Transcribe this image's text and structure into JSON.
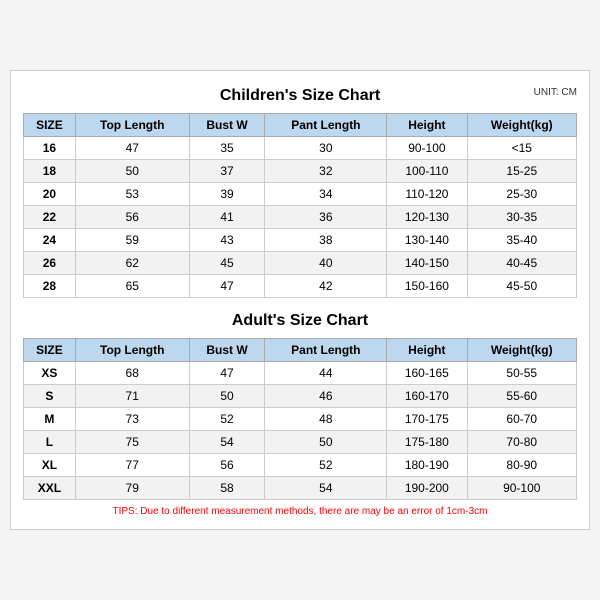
{
  "chart": {
    "title": "Children's Size Chart",
    "unit": "UNIT: CM",
    "children_headers": [
      "SIZE",
      "Top Length",
      "Bust W",
      "Pant Length",
      "Height",
      "Weight(kg)"
    ],
    "children_rows": [
      [
        "16",
        "47",
        "35",
        "30",
        "90-100",
        "<15"
      ],
      [
        "18",
        "50",
        "37",
        "32",
        "100-110",
        "15-25"
      ],
      [
        "20",
        "53",
        "39",
        "34",
        "110-120",
        "25-30"
      ],
      [
        "22",
        "56",
        "41",
        "36",
        "120-130",
        "30-35"
      ],
      [
        "24",
        "59",
        "43",
        "38",
        "130-140",
        "35-40"
      ],
      [
        "26",
        "62",
        "45",
        "40",
        "140-150",
        "40-45"
      ],
      [
        "28",
        "65",
        "47",
        "42",
        "150-160",
        "45-50"
      ]
    ],
    "adult_title": "Adult's Size Chart",
    "adult_headers": [
      "SIZE",
      "Top Length",
      "Bust W",
      "Pant Length",
      "Height",
      "Weight(kg)"
    ],
    "adult_rows": [
      [
        "XS",
        "68",
        "47",
        "44",
        "160-165",
        "50-55"
      ],
      [
        "S",
        "71",
        "50",
        "46",
        "160-170",
        "55-60"
      ],
      [
        "M",
        "73",
        "52",
        "48",
        "170-175",
        "60-70"
      ],
      [
        "L",
        "75",
        "54",
        "50",
        "175-180",
        "70-80"
      ],
      [
        "XL",
        "77",
        "56",
        "52",
        "180-190",
        "80-90"
      ],
      [
        "XXL",
        "79",
        "58",
        "54",
        "190-200",
        "90-100"
      ]
    ],
    "tips": "TIPS: Due to different measurement methods, there are may be an error of 1cm-3cm"
  }
}
